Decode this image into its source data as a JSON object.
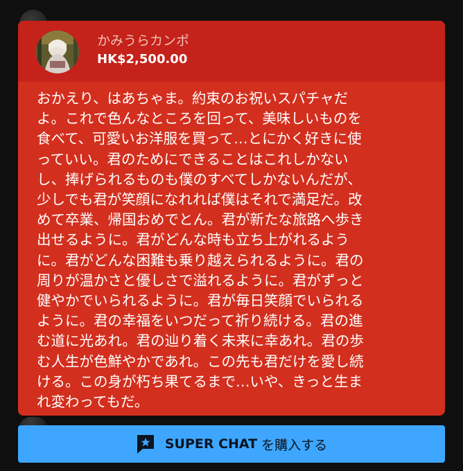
{
  "superchat": {
    "author": "かみうらカンポ",
    "amount": "HK$2,500.00",
    "message": "おかえり、はあちゃま。約束のお祝いスパチャだ\nよ。これで色んなところを回って、美味しいものを\n食べて、可愛いお洋服を買って…とにかく好きに使\nっていい。君のためにできることはこれしかない\nし、捧げられるものも僕のすべてしかないんだが、\n少しでも君が笑顔になれれば僕はそれで満足だ。改\nめて卒業、帰国おめでとん。君が新たな旅路へ歩き\n出せるように。君がどんな時も立ち上がれるよう\nに。君がどんな困難も乗り越えられるように。君の\n周りが温かさと優しさで溢れるように。君がずっと\n健やかでいられるように。君が毎日笑顔でいられる\nように。君の幸福をいつだって祈り続ける。君の進\nむ道に光あれ。君の辿り着く未来に幸あれ。君の歩\nむ人生が色鮮やかであれ。この先も君だけを愛し続\nける。この身が朽ち果てるまで…いや、きっと生ま\nれ変わってもだ。",
    "header_color": "#c4221a",
    "body_color": "#d32f1e"
  },
  "buy_button": {
    "label_bold": "SUPER CHAT",
    "label_rest": " を購入する",
    "color": "#3ea6ff",
    "icon": "superchat-icon"
  }
}
